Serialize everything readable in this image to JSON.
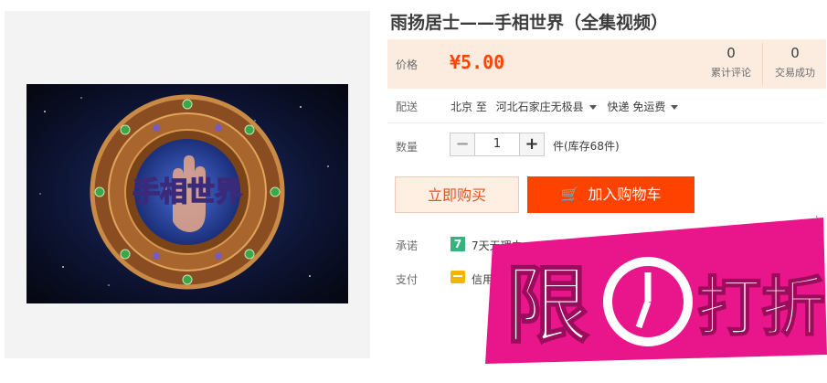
{
  "product": {
    "title": "雨扬居士——手相世界（全集视频）"
  },
  "image": {
    "caption": "手相世界"
  },
  "price": {
    "label": "价格",
    "value": "¥5.00"
  },
  "stats": [
    {
      "count": "0",
      "label": "累计评论"
    },
    {
      "count": "0",
      "label": "交易成功"
    }
  ],
  "shipping": {
    "label": "配送",
    "from": "北京 至",
    "to": "河北石家庄无极县",
    "method": "快递 免运费"
  },
  "quantity": {
    "label": "数量",
    "minus": "−",
    "value": "1",
    "plus": "+",
    "stock": "件(库存68件)"
  },
  "actions": {
    "buy_now": "立即购买",
    "add_to_cart": "加入购物车",
    "cart_icon": "🛒"
  },
  "promise": {
    "label": "承诺",
    "icon_text": "7",
    "text": "7天无理由"
  },
  "payment": {
    "label": "支付",
    "text": "信用"
  },
  "stray_mark": "\\",
  "banner": {
    "text_left": "限",
    "text_right": "打折",
    "colors": {
      "fill": "#e8168a",
      "outline": "#ffffff"
    }
  },
  "colors": {
    "accent": "#ff4200",
    "price": "#ff4400",
    "price_bg": "#fcece0"
  }
}
